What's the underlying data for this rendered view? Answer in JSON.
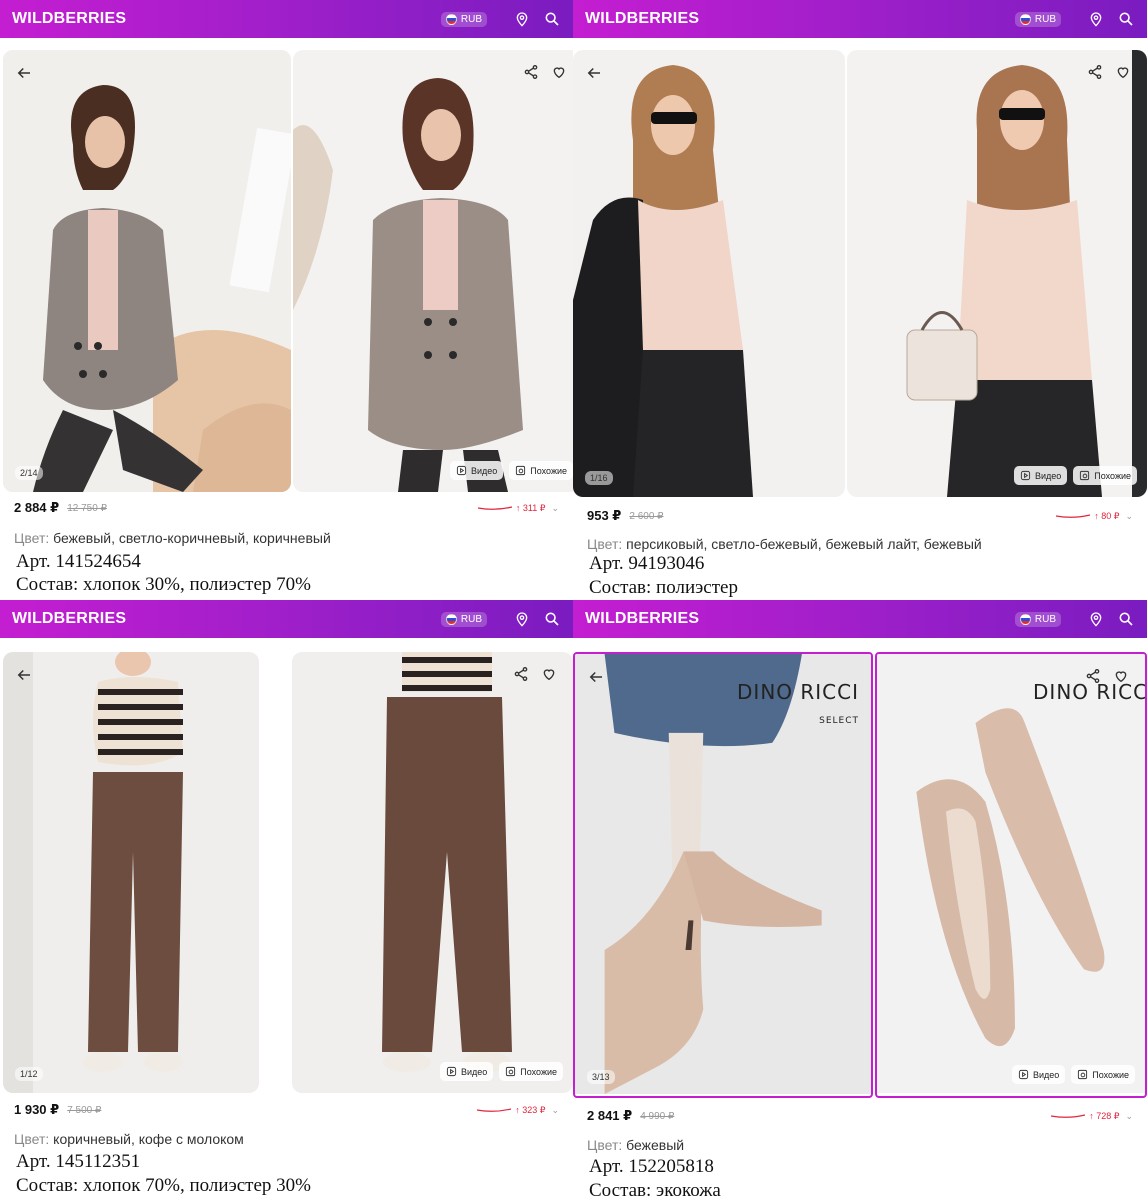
{
  "app": {
    "logo": "WILDBERRIES",
    "currency": "RUB",
    "colors": {
      "brand_start": "#c41ed1",
      "brand_end": "#7a1cc0",
      "price_up": "#e0253b"
    }
  },
  "labels": {
    "video": "Видео",
    "similar": "Похожие",
    "color_label": "Цвет:"
  },
  "panels": [
    {
      "counter": "2/14",
      "price": "2 884 ₽",
      "old_price": "12 750 ₽",
      "trend": "↑ 311 ₽",
      "color": "бежевый, светло-коричневый, коричневый",
      "article": "Арт. 141524654",
      "composition": "Состав: хлопок 30%, полиэстер 70%"
    },
    {
      "counter": "1/16",
      "price": "953 ₽",
      "old_price": "2 600 ₽",
      "trend": "↑ 80 ₽",
      "color": "персиковый, светло-бежевый, бежевый лайт, бежевый",
      "article": "Арт. 94193046",
      "composition": "Состав: полиэстер"
    },
    {
      "counter": "1/12",
      "price": "1 930 ₽",
      "old_price": "7 500 ₽",
      "trend": "↑ 323 ₽",
      "color": "коричневый, кофе с молоком",
      "article": "Арт. 145112351",
      "composition": "Состав: хлопок 70%, полиэстер 30%"
    },
    {
      "counter": "3/13",
      "price": "2 841 ₽",
      "old_price": "4 990 ₽",
      "trend": "↑ 728 ₽",
      "color": "бежевый",
      "article": "Арт. 152205818",
      "composition": "Состав: экокожа",
      "brand_mark": "DINO RICCI",
      "brand_sub": "SELECT"
    }
  ]
}
